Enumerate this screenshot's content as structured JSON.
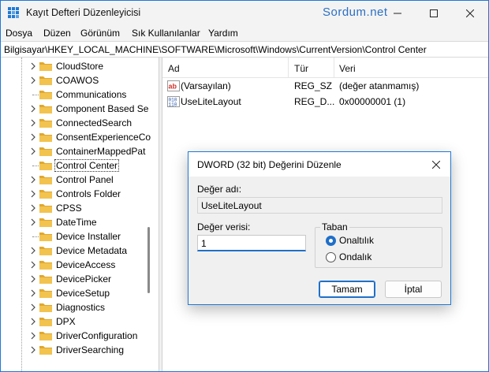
{
  "window": {
    "title": "Kayıt Defteri Düzenleyicisi",
    "watermark": "Sordum.net"
  },
  "menu": [
    "Dosya",
    "Düzen",
    "Görünüm",
    "Sık Kullanılanlar",
    "Yardım"
  ],
  "address": "Bilgisayar\\HKEY_LOCAL_MACHINE\\SOFTWARE\\Microsoft\\Windows\\CurrentVersion\\Control Center",
  "tree": {
    "items": [
      {
        "label": "CloudStore",
        "expandable": true
      },
      {
        "label": "COAWOS",
        "expandable": true
      },
      {
        "label": "Communications",
        "expandable": false
      },
      {
        "label": "Component Based Se",
        "expandable": true
      },
      {
        "label": "ConnectedSearch",
        "expandable": true
      },
      {
        "label": "ConsentExperienceCo",
        "expandable": true
      },
      {
        "label": "ContainerMappedPat",
        "expandable": true
      },
      {
        "label": "Control Center",
        "expandable": false,
        "selected": true
      },
      {
        "label": "Control Panel",
        "expandable": true
      },
      {
        "label": "Controls Folder",
        "expandable": true
      },
      {
        "label": "CPSS",
        "expandable": true
      },
      {
        "label": "DateTime",
        "expandable": true
      },
      {
        "label": "Device Installer",
        "expandable": false
      },
      {
        "label": "Device Metadata",
        "expandable": true
      },
      {
        "label": "DeviceAccess",
        "expandable": true
      },
      {
        "label": "DevicePicker",
        "expandable": true
      },
      {
        "label": "DeviceSetup",
        "expandable": true
      },
      {
        "label": "Diagnostics",
        "expandable": true
      },
      {
        "label": "DPX",
        "expandable": true
      },
      {
        "label": "DriverConfiguration",
        "expandable": true
      },
      {
        "label": "DriverSearching",
        "expandable": true
      }
    ]
  },
  "list": {
    "columns": [
      "Ad",
      "Tür",
      "Veri"
    ],
    "rows": [
      {
        "name": "(Varsayılan)",
        "type": "REG_SZ",
        "data": "(değer atanmamış)",
        "icon": "string-value-icon"
      },
      {
        "name": "UseLiteLayout",
        "type": "REG_D...",
        "data": "0x00000001 (1)",
        "icon": "dword-value-icon"
      }
    ]
  },
  "dialog": {
    "title": "DWORD (32 bit) Değerini Düzenle",
    "value_name_label": "Değer adı:",
    "value_name": "UseLiteLayout",
    "value_data_label": "Değer verisi:",
    "value_data": "1",
    "base_label": "Taban",
    "base_options": [
      {
        "label": "Onaltılık",
        "checked": true
      },
      {
        "label": "Ondalık",
        "checked": false
      }
    ],
    "ok_label": "Tamam",
    "cancel_label": "İptal"
  },
  "colors": {
    "accent": "#1f7ad6",
    "folder": "#f2c34e",
    "watermark": "#2b6fc4"
  }
}
